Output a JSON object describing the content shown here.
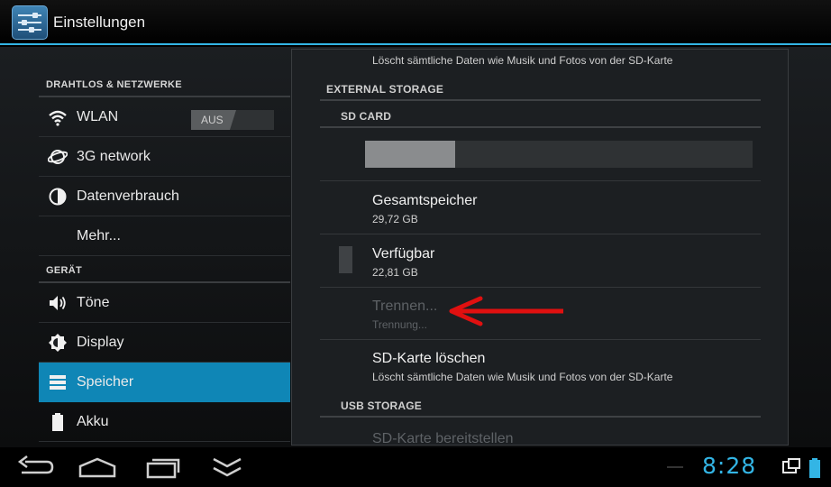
{
  "action_bar": {
    "title": "Einstellungen",
    "icon": "settings-sliders-icon",
    "accent": "#33b5e5"
  },
  "settings_list": {
    "sections": [
      {
        "header": "DRAHTLOS & NETZWERKE",
        "items": [
          {
            "label": "WLAN",
            "icon": "wifi-icon",
            "toggle": "AUS"
          },
          {
            "label": "3G network",
            "icon": "globe-icon"
          },
          {
            "label": "Datenverbrauch",
            "icon": "pie-chart-icon"
          },
          {
            "label": "Mehr..."
          }
        ]
      },
      {
        "header": "GERÄT",
        "items": [
          {
            "label": "Töne",
            "icon": "speaker-icon"
          },
          {
            "label": "Display",
            "icon": "brightness-icon"
          },
          {
            "label": "Speicher",
            "icon": "storage-icon",
            "selected": true
          },
          {
            "label": "Akku",
            "icon": "battery-icon"
          }
        ]
      }
    ],
    "selected_color": "#0f86b6"
  },
  "storage_panel": {
    "top_summary": "Löscht sämtliche Daten wie Musik und Fotos von der SD-Karte",
    "external_header": "EXTERNAL STORAGE",
    "sd_header": "SD CARD",
    "usage_fraction": 0.233,
    "total": {
      "title": "Gesamtspeicher",
      "value": "29,72 GB"
    },
    "available": {
      "title": "Verfügbar",
      "value": "22,81 GB"
    },
    "unmount": {
      "title": "Trennen...",
      "summary": "Trennung...",
      "disabled": true
    },
    "erase": {
      "title": "SD-Karte löschen",
      "summary": "Löscht sämtliche Daten wie Musik und Fotos von der SD-Karte"
    },
    "usb_header": "USB STORAGE",
    "usb_mount": {
      "title": "SD-Karte bereitstellen"
    },
    "annotation_arrow_color": "#e01010"
  },
  "nav_bar": {
    "buttons": [
      "back-icon",
      "home-icon",
      "recent-apps-icon",
      "hide-keyboard-icon"
    ],
    "clock": "8:28",
    "status_icons": [
      "screenshot-icon",
      "battery-status-icon"
    ]
  }
}
